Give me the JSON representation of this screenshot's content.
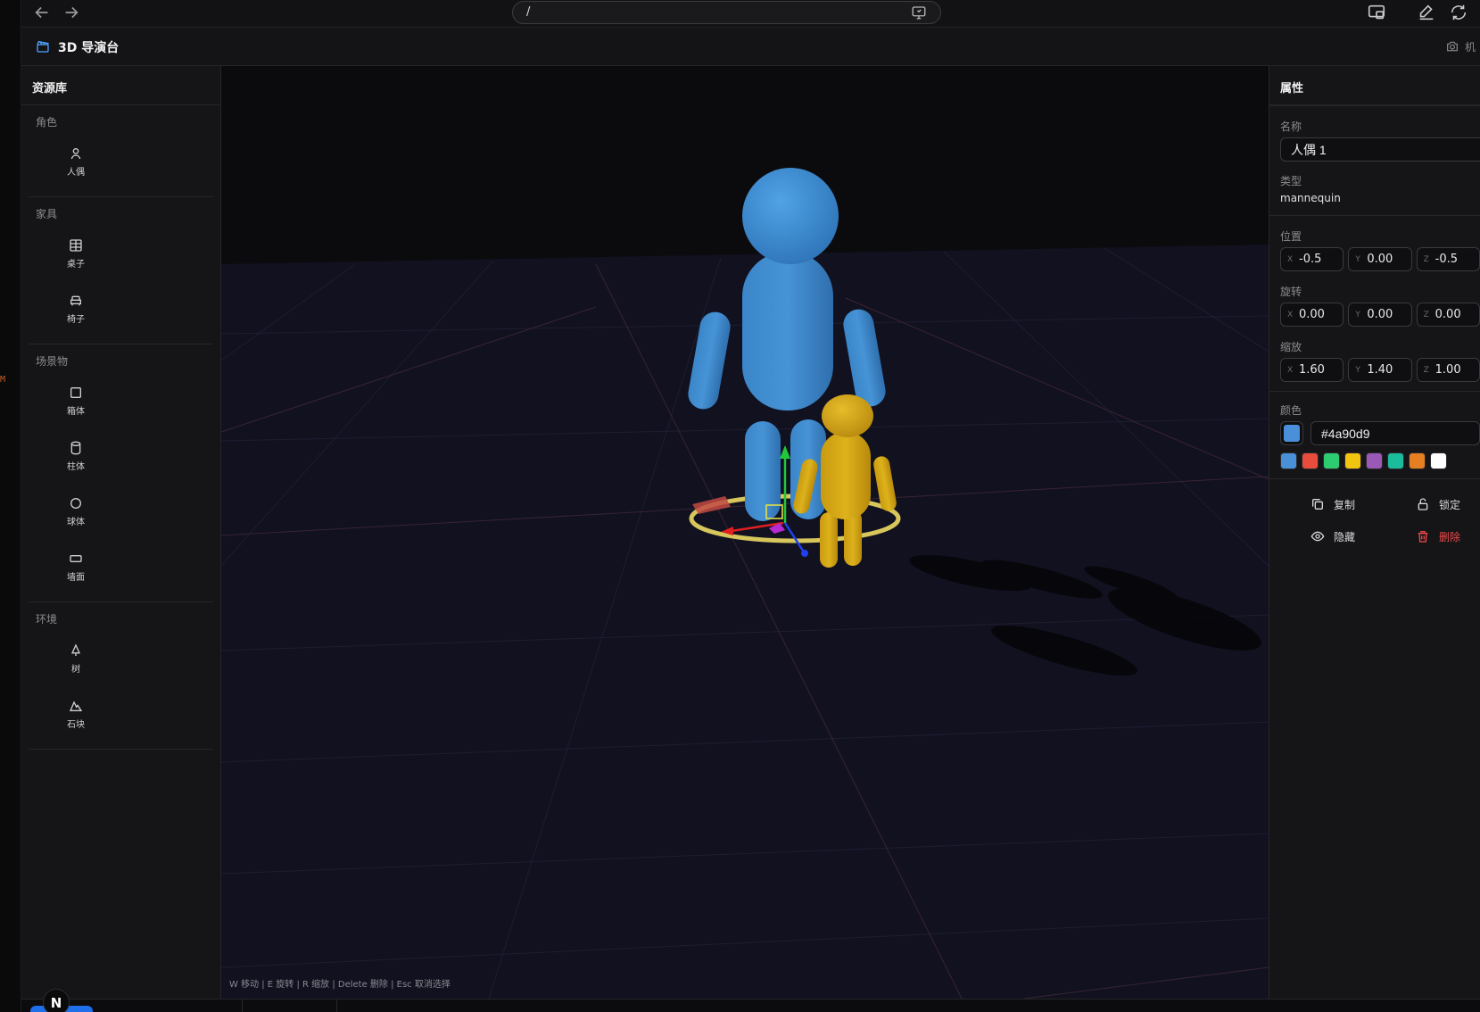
{
  "browser": {
    "url": "/",
    "left_mark": "M"
  },
  "header": {
    "title": "3D 导演台",
    "camera_label": "机"
  },
  "assets": {
    "title": "资源库",
    "categories": [
      {
        "label": "角色",
        "items": [
          {
            "label": "人偶",
            "icon": "person-icon"
          }
        ]
      },
      {
        "label": "家具",
        "items": [
          {
            "label": "桌子",
            "icon": "table-icon"
          },
          {
            "label": "椅子",
            "icon": "armchair-icon"
          }
        ]
      },
      {
        "label": "场景物",
        "items": [
          {
            "label": "箱体",
            "icon": "square-icon"
          },
          {
            "label": "柱体",
            "icon": "cylinder-icon"
          },
          {
            "label": "球体",
            "icon": "circle-icon"
          },
          {
            "label": "墙面",
            "icon": "rectangle-icon"
          }
        ]
      },
      {
        "label": "环境",
        "items": [
          {
            "label": "树",
            "icon": "tree-icon"
          },
          {
            "label": "石块",
            "icon": "mountain-icon"
          }
        ]
      }
    ]
  },
  "viewport": {
    "hint": "W 移动 | E 旋转 | R 缩放 | Delete 删除 | Esc 取消选择",
    "objects": [
      {
        "type": "mannequin",
        "color": "#4a90d9"
      },
      {
        "type": "mannequin",
        "color": "#d4af37"
      }
    ]
  },
  "properties": {
    "title": "属性",
    "name_label": "名称",
    "name_value": "人偶 1",
    "type_label": "类型",
    "type_value": "mannequin",
    "position_label": "位置",
    "position": {
      "x": "-0.5",
      "y": "0.00",
      "z": "-0.5"
    },
    "rotation_label": "旋转",
    "rotation": {
      "x": "0.00",
      "y": "0.00",
      "z": "0.00"
    },
    "scale_label": "缩放",
    "scale": {
      "x": "1.60",
      "y": "1.40",
      "z": "1.00"
    },
    "axis_labels": {
      "x": "X",
      "y": "Y",
      "z": "Z"
    },
    "color_label": "颜色",
    "color_value": "#4a90d9",
    "presets": [
      "#4a90d9",
      "#e74c3c",
      "#2ecc71",
      "#f1c40f",
      "#9b59b6",
      "#1abc9c",
      "#e67e22",
      "#ffffff"
    ],
    "actions": {
      "copy": "复制",
      "lock": "锁定",
      "hide": "隐藏",
      "delete": "删除"
    }
  },
  "bottom": {
    "badge": "N"
  }
}
